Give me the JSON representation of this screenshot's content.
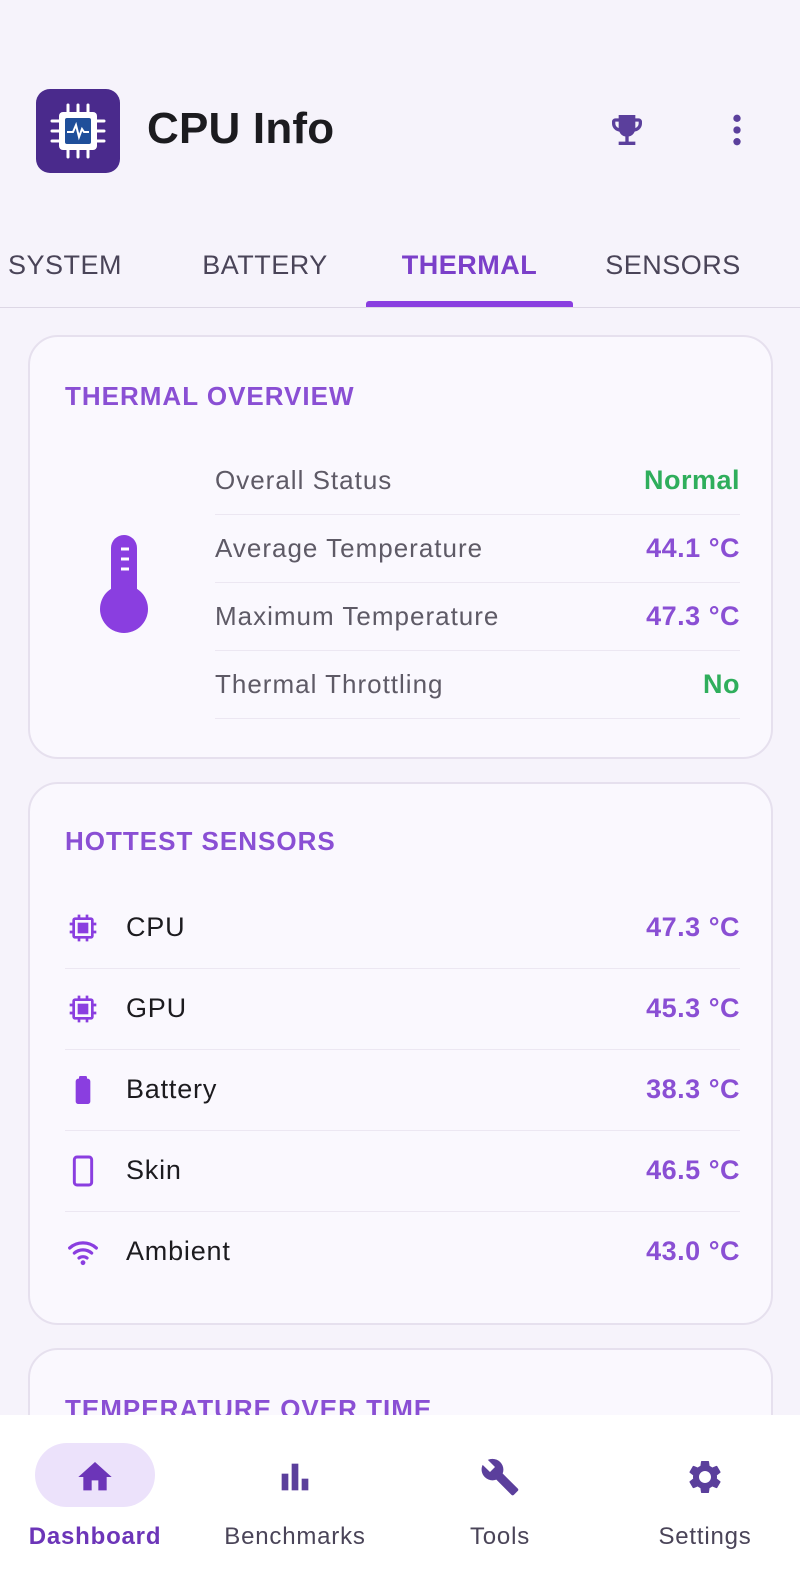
{
  "app": {
    "title": "CPU Info",
    "accent": "#8a4fd4",
    "success": "#2fae5c"
  },
  "header": {
    "logo_icon": "cpu-chip-logo-icon",
    "actions": [
      {
        "icon": "trophy-icon"
      },
      {
        "icon": "more-vert-icon"
      }
    ]
  },
  "tabs": [
    {
      "label": "SYSTEM",
      "active": false
    },
    {
      "label": "BATTERY",
      "active": false
    },
    {
      "label": "THERMAL",
      "active": true
    },
    {
      "label": "SENSORS",
      "active": false
    }
  ],
  "thermal_overview": {
    "title": "THERMAL OVERVIEW",
    "icon": "thermometer-icon",
    "rows": [
      {
        "label": "Overall Status",
        "value": "Normal"
      },
      {
        "label": "Average Temperature",
        "value": "44.1 °C"
      },
      {
        "label": "Maximum Temperature",
        "value": "47.3 °C"
      },
      {
        "label": "Thermal Throttling",
        "value": "No"
      }
    ]
  },
  "hottest_sensors": {
    "title": "HOTTEST SENSORS",
    "rows": [
      {
        "icon": "chip-icon",
        "name": "CPU",
        "value": "47.3 °C"
      },
      {
        "icon": "chip-icon",
        "name": "GPU",
        "value": "45.3 °C"
      },
      {
        "icon": "battery-icon",
        "name": "Battery",
        "value": "38.3 °C"
      },
      {
        "icon": "phone-icon",
        "name": "Skin",
        "value": "46.5 °C"
      },
      {
        "icon": "wifi-icon",
        "name": "Ambient",
        "value": "43.0 °C"
      }
    ]
  },
  "temperature_over_time": {
    "title": "TEMPERATURE OVER TIME"
  },
  "bottom_nav": [
    {
      "label": "Dashboard",
      "icon": "home-icon",
      "active": true
    },
    {
      "label": "Benchmarks",
      "icon": "bar-chart-icon",
      "active": false
    },
    {
      "label": "Tools",
      "icon": "wrench-icon",
      "active": false
    },
    {
      "label": "Settings",
      "icon": "gear-icon",
      "active": false
    }
  ]
}
